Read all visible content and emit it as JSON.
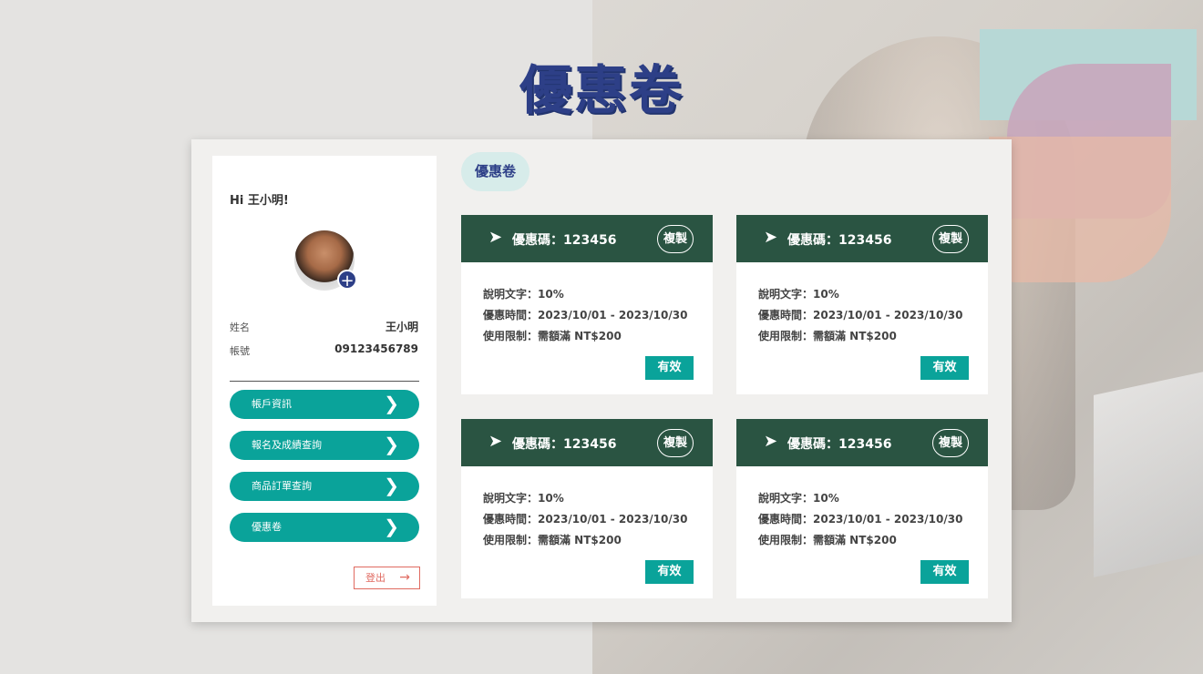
{
  "page_title": "優惠卷",
  "sidebar": {
    "greeting": "Hi 王小明!",
    "avatar_add": "+",
    "name_label": "姓名",
    "name_value": "王小明",
    "account_label": "帳號",
    "account_value": "09123456789",
    "nav": [
      {
        "label": "帳戶資訊"
      },
      {
        "label": "報名及成績查詢"
      },
      {
        "label": "商品訂單查詢"
      },
      {
        "label": "優惠卷"
      }
    ],
    "logout_label": "登出",
    "logout_arrow": "→"
  },
  "section_title": "優惠卷",
  "coupons": [
    {
      "code": "優惠碼：123456",
      "copy": "複製",
      "desc": "說明文字：10%",
      "period": "優惠時間：2023/10/01 - 2023/10/30",
      "limit": "使用限制：需額滿 NT$200",
      "status": "有效"
    },
    {
      "code": "優惠碼：123456",
      "copy": "複製",
      "desc": "說明文字：10%",
      "period": "優惠時間：2023/10/01 - 2023/10/30",
      "limit": "使用限制：需額滿 NT$200",
      "status": "有效"
    },
    {
      "code": "優惠碼：123456",
      "copy": "複製",
      "desc": "說明文字：10%",
      "period": "優惠時間：2023/10/01 - 2023/10/30",
      "limit": "使用限制：需額滿 NT$200",
      "status": "有效"
    },
    {
      "code": "優惠碼：123456",
      "copy": "複製",
      "desc": "說明文字：10%",
      "period": "優惠時間：2023/10/01 - 2023/10/30",
      "limit": "使用限制：需額滿 NT$200",
      "status": "有效"
    }
  ],
  "colors": {
    "brand_navy": "#2d3f87",
    "teal": "#0aa39a",
    "coupon_header": "#2a5442",
    "logout_red": "#e06a60"
  },
  "icons": {
    "plane": "send-icon",
    "chevron": "chevron-right-icon",
    "add": "plus-icon",
    "arrow": "arrow-right-icon"
  }
}
